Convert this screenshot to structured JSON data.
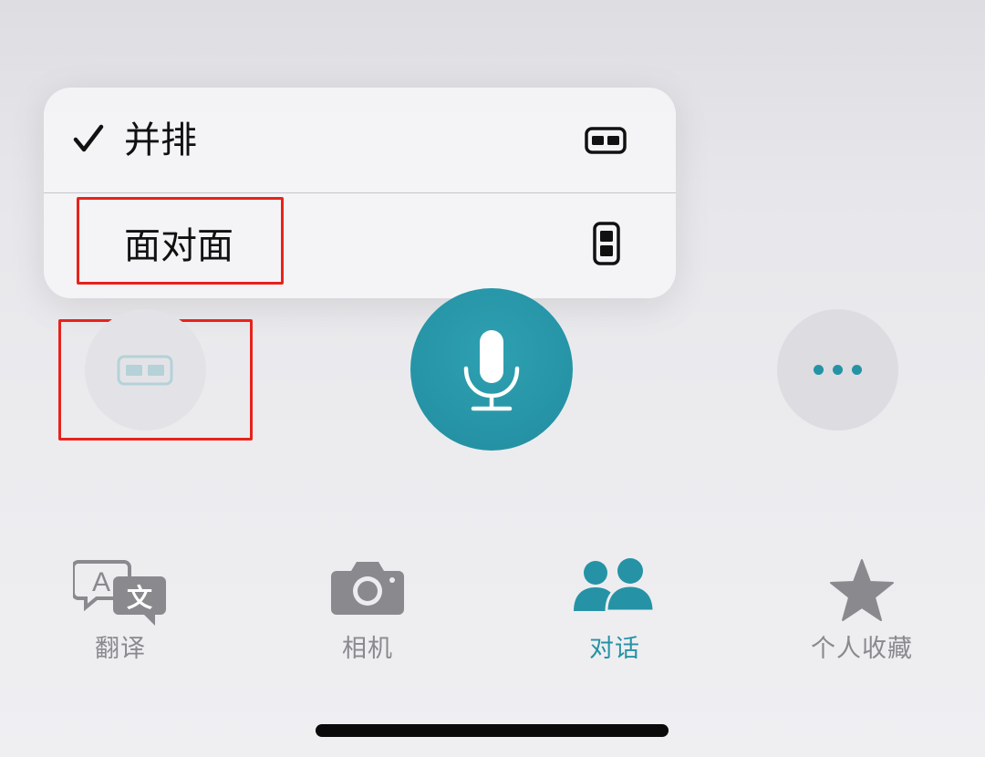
{
  "menu": {
    "items": [
      {
        "label": "并排",
        "checked": true,
        "icon": "side-by-side-icon"
      },
      {
        "label": "面对面",
        "checked": false,
        "icon": "face-to-face-icon"
      }
    ]
  },
  "controls": {
    "layout_icon": "side-by-side-icon",
    "mic_icon": "microphone-icon",
    "more_icon": "ellipsis-icon"
  },
  "tabs": [
    {
      "label": "翻译",
      "icon": "translate-icon",
      "active": false
    },
    {
      "label": "相机",
      "icon": "camera-icon",
      "active": false
    },
    {
      "label": "对话",
      "icon": "conversation-icon",
      "active": true
    },
    {
      "label": "个人收藏",
      "icon": "star-icon",
      "active": false
    }
  ],
  "colors": {
    "accent": "#2593a5",
    "inactive": "#8a8a8e",
    "annotation": "#e8221b"
  }
}
